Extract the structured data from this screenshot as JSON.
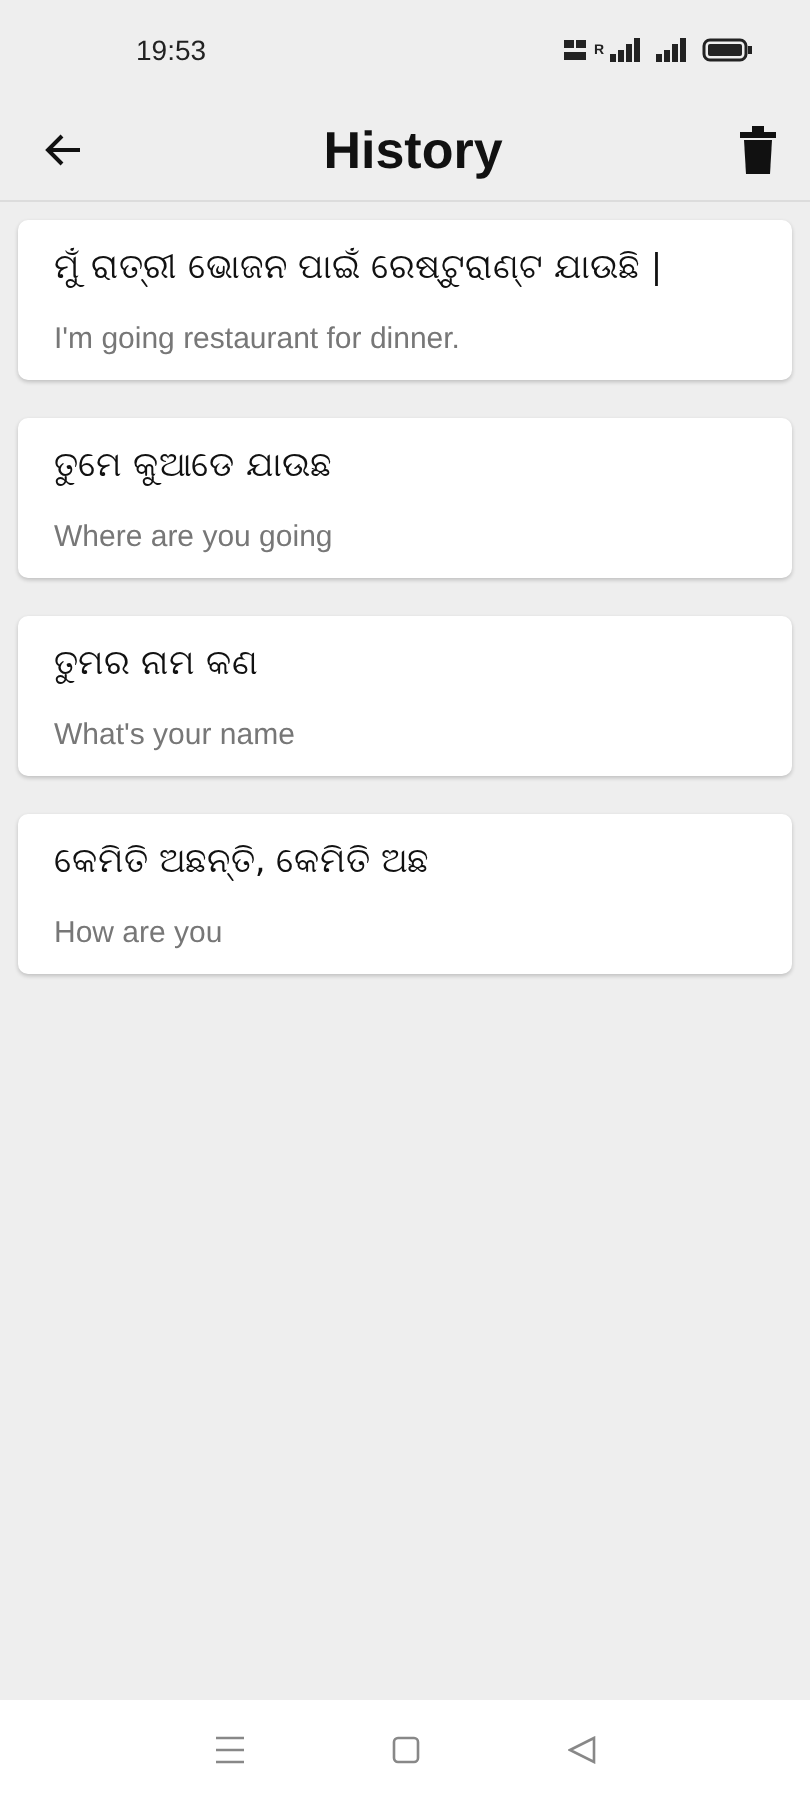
{
  "status_bar": {
    "time": "19:53",
    "roaming": "R"
  },
  "app_bar": {
    "title": "History"
  },
  "history": [
    {
      "source": "ମୁଁ ରାତ୍ରୀ ଭୋଜନ ପାଇଁ ରେଷ୍ଟୁରାଣ୍ଟ ଯାଉଛି |",
      "translation": "I'm going restaurant for dinner."
    },
    {
      "source": "ତୁମେ କୁଆଡେ ଯାଉଛ",
      "translation": "Where are you going"
    },
    {
      "source": "ତୁମର ନାମ କଣ",
      "translation": "What's your name"
    },
    {
      "source": "କେମିତି ଅଛନ୍ତି, କେମିତି ଅଛ",
      "translation": "How are you"
    }
  ]
}
